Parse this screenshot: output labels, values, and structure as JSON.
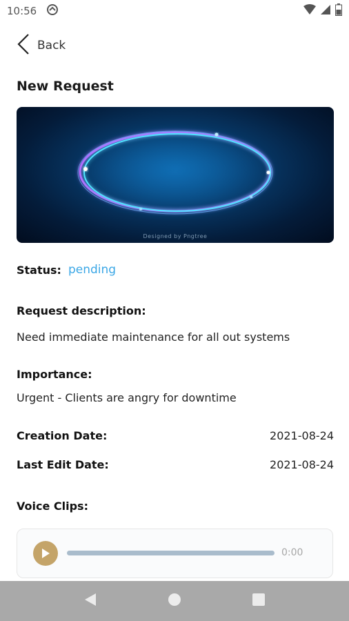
{
  "status_bar": {
    "time": "10:56",
    "icons": [
      "sync-circle-icon",
      "wifi-icon",
      "cellular-signal-icon",
      "battery-icon"
    ]
  },
  "nav": {
    "back_label": "Back"
  },
  "page": {
    "title": "New Request"
  },
  "hero_image": {
    "caption": "Designed by Pngtree"
  },
  "status": {
    "label": "Status:",
    "value": "pending",
    "value_color": "#3aa7e6"
  },
  "description": {
    "label": "Request description:",
    "value": "Need immediate maintenance for all out systems"
  },
  "importance": {
    "label": "Importance:",
    "value": "Urgent - Clients are angry for downtime"
  },
  "creation_date": {
    "label": "Creation Date:",
    "value": "2021-08-24"
  },
  "last_edit_date": {
    "label": "Last Edit Date:",
    "value": "2021-08-24"
  },
  "voice_clips": {
    "label": "Voice Clips:",
    "clips": [
      {
        "time": "0:00",
        "progress": 0.0
      }
    ],
    "accent_color": "#c4a469"
  },
  "system_nav": {
    "icons": [
      "back-triangle-icon",
      "home-circle-icon",
      "recents-square-icon"
    ]
  }
}
